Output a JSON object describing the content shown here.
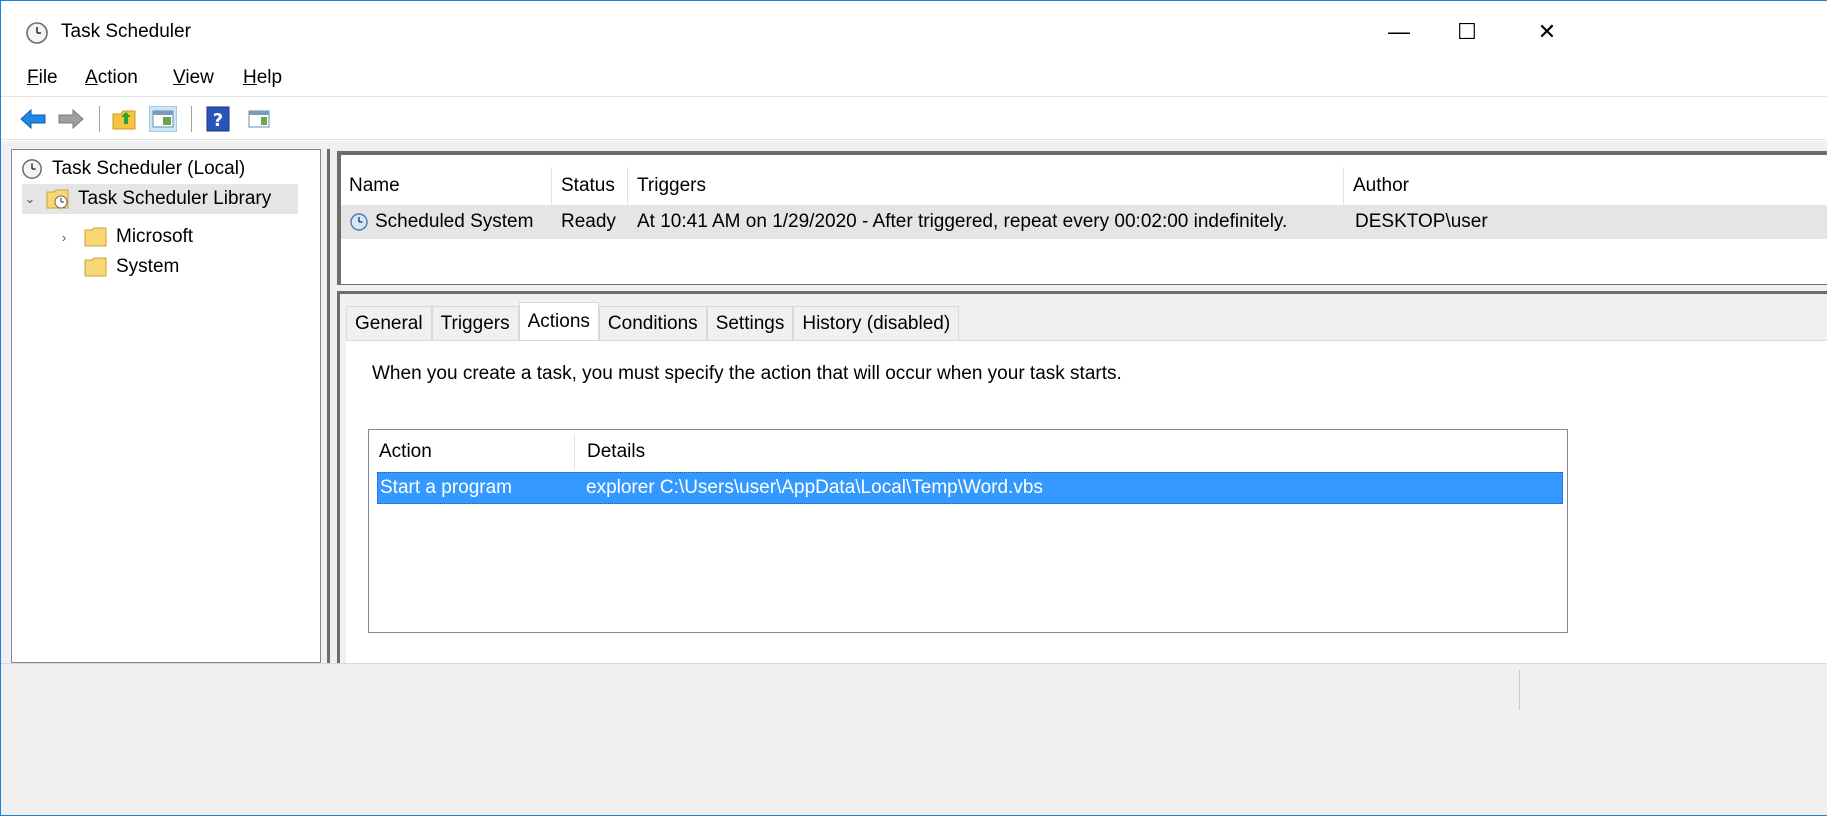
{
  "window": {
    "title": "Task Scheduler",
    "controls": {
      "minimize": "—",
      "maximize": "☐",
      "close": "✕"
    }
  },
  "menu": [
    {
      "label": "File",
      "accel": "F",
      "rest": "ile"
    },
    {
      "label": "Action",
      "accel": "A",
      "rest": "ction"
    },
    {
      "label": "View",
      "accel": "V",
      "rest": "iew"
    },
    {
      "label": "Help",
      "accel": "H",
      "rest": "elp"
    }
  ],
  "toolbar": {
    "icons": [
      "back-arrow-icon",
      "forward-arrow-icon",
      "folder-up-icon",
      "show-hide-console-tree-icon",
      "help-icon",
      "show-hide-action-pane-icon"
    ]
  },
  "tree": {
    "root": "Task Scheduler (Local)",
    "library": "Task Scheduler Library",
    "children": [
      "Microsoft",
      "System"
    ]
  },
  "task_list": {
    "headers": {
      "name": "Name",
      "status": "Status",
      "triggers": "Triggers",
      "author": "Author"
    },
    "rows": [
      {
        "name": "Scheduled System",
        "status": "Ready",
        "triggers": "At 10:41 AM on 1/29/2020 - After triggered, repeat every 00:02:00 indefinitely.",
        "author": "DESKTOP\\user"
      }
    ]
  },
  "tabs": {
    "items": [
      "General",
      "Triggers",
      "Actions",
      "Conditions",
      "Settings",
      "History (disabled)"
    ],
    "active": "Actions"
  },
  "actions_tab": {
    "description": "When you create a task, you must specify the action that will occur when your task starts.",
    "headers": {
      "action": "Action",
      "details": "Details"
    },
    "rows": [
      {
        "action": "Start a program",
        "details": "explorer C:\\Users\\user\\AppData\\Local\\Temp\\Word.vbs"
      }
    ]
  },
  "colors": {
    "accent_border": "#1883d7",
    "selection": "#3399ff",
    "pane_bg": "#f0f0f0"
  }
}
